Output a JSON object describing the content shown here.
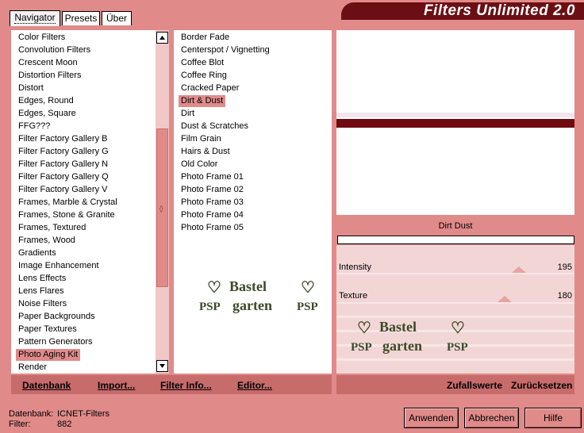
{
  "app": {
    "title": "Filters Unlimited 2.0"
  },
  "tabs": [
    {
      "label": "Navigator"
    },
    {
      "label": "Presets"
    },
    {
      "label": "Über"
    }
  ],
  "categories": [
    "Color Filters",
    "Convolution Filters",
    "Crescent Moon",
    "Distortion Filters",
    "Distort",
    "Edges, Round",
    "Edges, Square",
    "FFG???",
    "Filter Factory Gallery B",
    "Filter Factory Gallery G",
    "Filter Factory Gallery N",
    "Filter Factory Gallery Q",
    "Filter Factory Gallery V",
    "Frames, Marble & Crystal",
    "Frames, Stone & Granite",
    "Frames, Textured",
    "Frames, Wood",
    "Gradients",
    "Image Enhancement",
    "Lens Effects",
    "Lens Flares",
    "Noise Filters",
    "Paper Backgrounds",
    "Paper Textures",
    "Pattern Generators",
    "Photo Aging Kit",
    "Render"
  ],
  "selected_category": "Photo Aging Kit",
  "filters": [
    "Border Fade",
    "Centerspot / Vignetting",
    "Coffee Blot",
    "Coffee Ring",
    "Cracked Paper",
    "Dirt & Dust",
    "Dirt",
    "Dust & Scratches",
    "Film Grain",
    "Hairs & Dust",
    "Old Color",
    "Photo Frame 01",
    "Photo Frame 02",
    "Photo Frame 03",
    "Photo Frame 04",
    "Photo Frame 05"
  ],
  "selected_filter": "Dirt & Dust",
  "preview": {
    "filter_name": "Dirt  Dust"
  },
  "sliders": [
    {
      "label": "Intensity",
      "value": "195",
      "level": 0.765
    },
    {
      "label": "Texture",
      "value": "180",
      "level": 0.706
    }
  ],
  "toolbar": {
    "database": "Datenbank",
    "import": "Import...",
    "filter_info": "Filter Info...",
    "editor": "Editor...",
    "random": "Zufallswerte",
    "reset": "Zurücksetzen"
  },
  "status": {
    "db_label": "Datenbank:",
    "db_value": "ICNET-Filters",
    "filter_label": "Filter:",
    "filter_count": "882"
  },
  "buttons": {
    "apply": "Anwenden",
    "cancel": "Abbrechen",
    "help": "Hilfe"
  },
  "watermark": {
    "line1": "Bastel",
    "line2": "garten",
    "mark": "PSP"
  },
  "colors": {
    "background": "#e08a8a",
    "title_band": "#6b0f14",
    "selection": "#e08a8a",
    "watermark": "#3a4a26"
  }
}
